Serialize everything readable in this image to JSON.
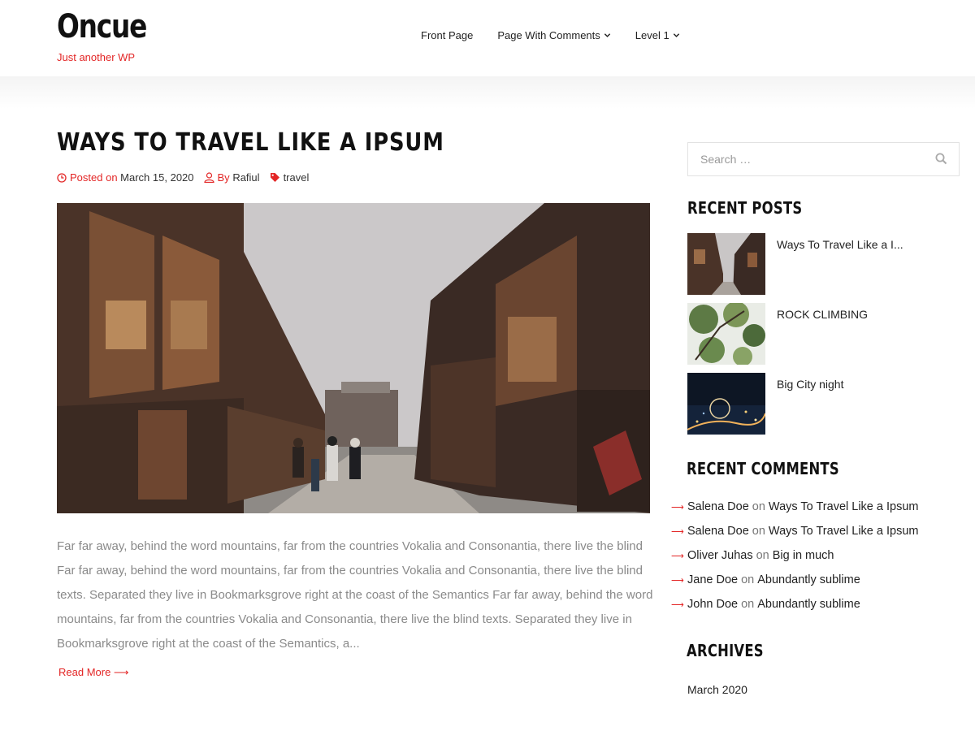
{
  "site": {
    "title": "Oncue",
    "tagline": "Just another WP"
  },
  "nav": [
    {
      "label": "Front Page",
      "has_dropdown": false
    },
    {
      "label": "Page With Comments",
      "has_dropdown": true
    },
    {
      "label": "Level 1",
      "has_dropdown": true
    }
  ],
  "post": {
    "title": "WAYS TO TRAVEL LIKE A IPSUM",
    "posted_label": "Posted on",
    "date": "March 15, 2020",
    "by_label": "By",
    "author": "Rafiul",
    "tag": "travel",
    "excerpt_lines": [
      "Far far away, behind the word mountains, far from the countries Vokalia and Consonantia, there live the blind",
      " Far far away, behind the word mountains, far from the countries Vokalia and Consonantia, there live the blind",
      " texts. Separated they live in Bookmarksgrove right at the coast of the Semantics Far far away, behind the word",
      " mountains, far from the countries Vokalia and Consonantia, there live the blind texts. Separated they live in",
      " Bookmarksgrove right at the coast of the Semantics, a..."
    ],
    "read_more": "Read More ⟶"
  },
  "sidebar": {
    "search_placeholder": "Search …",
    "recent_posts_title": "RECENT POSTS",
    "recent_posts": [
      {
        "title": "Ways To Travel Like a I..."
      },
      {
        "title": "ROCK CLIMBING"
      },
      {
        "title": "Big City night"
      }
    ],
    "recent_comments_title": "RECENT COMMENTS",
    "recent_comments": [
      {
        "author": "Salena Doe",
        "on": "on",
        "post": "Ways To Travel Like a Ipsum"
      },
      {
        "author": "Salena Doe",
        "on": "on",
        "post": "Ways To Travel Like a Ipsum"
      },
      {
        "author": "Oliver Juhas",
        "on": "on",
        "post": "Big in much"
      },
      {
        "author": "Jane Doe",
        "on": "on",
        "post": "Abundantly sublime"
      },
      {
        "author": "John Doe",
        "on": "on",
        "post": "Abundantly sublime"
      }
    ],
    "archives_title": "ARCHIVES",
    "archives": [
      "March 2020"
    ]
  },
  "colors": {
    "accent": "#e32626",
    "text": "#222222",
    "muted": "#8a8a8a"
  }
}
